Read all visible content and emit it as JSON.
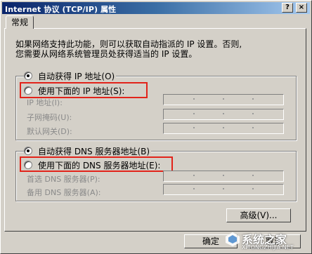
{
  "window": {
    "title": "Internet 协议 (TCP/IP) 属性",
    "help_label": "?",
    "close_label": "×"
  },
  "tabs": [
    {
      "label": "常规"
    }
  ],
  "intro": {
    "line1": "如果网络支持此功能，则可以获取自动指派的 IP 设置。否则,",
    "line2": "您需要从网络系统管理员处获得适当的 IP 设置。"
  },
  "ip_section": {
    "auto_option": {
      "label": "自动获得 IP 地址(O)",
      "selected": true
    },
    "manual_option": {
      "label": "使用下面的 IP 地址(S):",
      "selected": false
    },
    "fields": [
      {
        "label": "IP 地址(I):",
        "value": ""
      },
      {
        "label": "子网掩码(U):",
        "value": ""
      },
      {
        "label": "默认网关(D):",
        "value": ""
      }
    ]
  },
  "dns_section": {
    "auto_option": {
      "label": "自动获得 DNS 服务器地址(B)",
      "selected": true
    },
    "manual_option": {
      "label": "使用下面的 DNS 服务器地址(E):",
      "selected": false
    },
    "fields": [
      {
        "label": "首选 DNS 服务器(P):",
        "value": ""
      },
      {
        "label": "备用 DNS 服务器(A):",
        "value": ""
      }
    ]
  },
  "buttons": {
    "advanced": "高级(V)...",
    "ok": "确定",
    "cancel": "取消"
  },
  "watermark": {
    "text": "系统之家",
    "url": "XITONGZHIJIA.NET"
  },
  "colors": {
    "highlight": "#e2231a",
    "titlebar": "#0a246a",
    "face": "#d4d0c8"
  }
}
